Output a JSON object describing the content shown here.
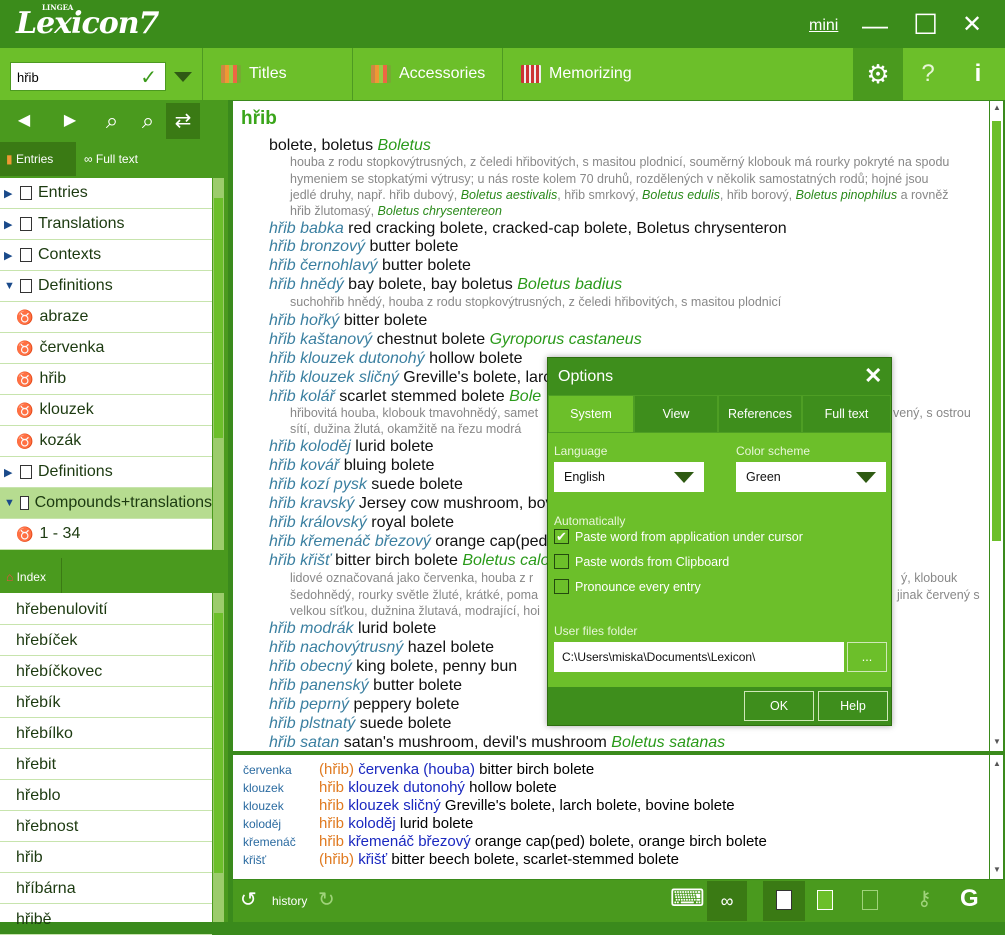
{
  "app": {
    "logo_brand": "LINGEA",
    "logo_text": "Lexicon7",
    "mini_label": "mini"
  },
  "window": {
    "minimize_glyph": "—",
    "maximize_glyph": "☐",
    "close_glyph": "✕"
  },
  "search": {
    "value": "hřib",
    "ok_glyph": "✓"
  },
  "toolbar": {
    "titles": "Titles",
    "accessories": "Accessories",
    "memorizing": "Memorizing",
    "gear": "⚙",
    "help": "?",
    "info": "i"
  },
  "nav": {
    "back": "◀",
    "forward": "▶",
    "search": "⌕",
    "search_in": "⌕",
    "swap": "⇄"
  },
  "left_tabs": {
    "entries": "Entries",
    "fulltext": "Full text"
  },
  "tree": [
    {
      "label": "Entries",
      "kind": "collapsed"
    },
    {
      "label": "Translations",
      "kind": "collapsed"
    },
    {
      "label": "Contexts",
      "kind": "collapsed"
    },
    {
      "label": "Definitions",
      "kind": "expanded"
    },
    {
      "label": "abraze",
      "kind": "leaf"
    },
    {
      "label": "červenka",
      "kind": "leaf"
    },
    {
      "label": "hřib",
      "kind": "leaf"
    },
    {
      "label": "klouzek",
      "kind": "leaf"
    },
    {
      "label": "kozák",
      "kind": "leaf"
    },
    {
      "label": "Definitions",
      "kind": "collapsed"
    },
    {
      "label": "Compounds+translations",
      "kind": "expanded-selected"
    },
    {
      "label": "1 - 34",
      "kind": "leaf"
    }
  ],
  "index": {
    "tab": "Index",
    "items": [
      "hřebenulovití",
      "hřebíček",
      "hřebíčkovec",
      "hřebík",
      "hřebílko",
      "hřebit",
      "hřeblo",
      "hřebnost",
      "hřib",
      "hříbárna",
      "hřibě"
    ]
  },
  "entry": {
    "headword": "hřib",
    "main_translation": "bolete, boletus",
    "main_latin": "Boletus",
    "gloss1": "houba z rodu stopkovýtrusných, z čeledi hřibovitých, s masitou plodnicí, souměrný klobouk má rourky pokryté na spodu",
    "gloss2": "hymeniem se stopkatými výtrusy; u nás roste kolem 70 druhů, rozdělených v několik samostatných rodů; hojné jsou",
    "gloss3a": "jedlé druhy, např. hřib dubový,",
    "gloss3b": "Boletus aestivalis",
    "gloss3c": ", hřib smrkový,",
    "gloss3d": "Boletus edulis",
    "gloss3e": ", hřib borový,",
    "gloss3f": "Boletus pinophilus",
    "gloss3g": "a rovněž",
    "gloss4a": "hřib žlutomasý,",
    "gloss4b": "Boletus chrysentereon",
    "compounds": [
      {
        "cz": "hřib babka",
        "en": "red cracking bolete, cracked-cap bolete, Boletus chrysenteron",
        "lat": ""
      },
      {
        "cz": "hřib bronzový",
        "en": "butter bolete",
        "lat": ""
      },
      {
        "cz": "hřib černohlavý",
        "en": "butter bolete",
        "lat": ""
      },
      {
        "cz": "hřib hnědý",
        "en": "bay bolete, bay boletus",
        "lat": "Boletus badius"
      },
      {
        "cz": "hřib hořký",
        "en": "bitter bolete",
        "lat": ""
      },
      {
        "cz": "hřib kaštanový",
        "en": "chestnut bolete",
        "lat": "Gyroporus castaneus"
      },
      {
        "cz": "hřib klouzek dutonohý",
        "en": "hollow bolete",
        "lat": ""
      },
      {
        "cz": "hřib klouzek sličný",
        "en": "Greville's bolete, larc",
        "lat": ""
      },
      {
        "cz": "hřib kolář",
        "en": "scarlet stemmed bolete",
        "lat": "Bole"
      },
      {
        "cz": "hřib koloděj",
        "en": "lurid bolete",
        "lat": ""
      },
      {
        "cz": "hřib kovář",
        "en": "bluing bolete",
        "lat": ""
      },
      {
        "cz": "hřib kozí pysk",
        "en": "suede bolete",
        "lat": ""
      },
      {
        "cz": "hřib kravský",
        "en": "Jersey cow mushroom, bov",
        "lat": ""
      },
      {
        "cz": "hřib královský",
        "en": "royal bolete",
        "lat": ""
      },
      {
        "cz": "hřib křemenáč březový",
        "en": "orange cap(ped",
        "lat": ""
      },
      {
        "cz": "hřib křišť",
        "en": "bitter birch bolete",
        "lat": "Boletus calo"
      },
      {
        "cz": "hřib modrák",
        "en": "lurid bolete",
        "lat": ""
      },
      {
        "cz": "hřib nachovýtrusný",
        "en": "hazel bolete",
        "lat": ""
      },
      {
        "cz": "hřib obecný",
        "en": "king bolete, penny bun",
        "lat": ""
      },
      {
        "cz": "hřib panenský",
        "en": "butter bolete",
        "lat": ""
      },
      {
        "cz": "hřib peprný",
        "en": "peppery bolete",
        "lat": ""
      },
      {
        "cz": "hřib plstnatý",
        "en": "suede bolete",
        "lat": ""
      },
      {
        "cz": "hřib satan",
        "en": "satan's mushroom, devil's mushroom",
        "lat": "Boletus satanas"
      }
    ],
    "gloss_hnedy": "suchohřib hnědý, houba z rodu stopkovýtrusných, z čeledi hřibovitých, s masitou plodnicí",
    "gloss_kolar1": "hřibovitá houba, klobouk tmavohnědý, samet",
    "gloss_kolar1b": "vený, s ostrou",
    "gloss_kolar2": "sítí, dužina žlutá, okamžitě na řezu modrá",
    "gloss_kris1": "lidové označovaná jako červenka, houba z r",
    "gloss_kris1b": "ý, klobouk",
    "gloss_kris2": "šedohnědý, rourky světle žluté, krátké, poma",
    "gloss_kris2b": "jinak červený s",
    "gloss_kris3": "velkou síťkou, dužnina žlutavá, modrající, hoi"
  },
  "lower": [
    {
      "key": "červenka",
      "a": "(hřib)",
      "b": "červenka",
      "c": "(houba)",
      "d": "bitter birch bolete",
      "a_paren": true
    },
    {
      "key": "klouzek",
      "a": "hřib",
      "b": "klouzek dutonohý",
      "c": "",
      "d": "hollow bolete",
      "a_paren": false
    },
    {
      "key": "klouzek",
      "a": "hřib",
      "b": "klouzek sličný",
      "c": "",
      "d": "Greville's bolete, larch bolete, bovine bolete",
      "a_paren": false
    },
    {
      "key": "koloděj",
      "a": "hřib",
      "b": "koloděj",
      "c": "",
      "d": "lurid bolete",
      "a_paren": false
    },
    {
      "key": "křemenáč",
      "a": "hřib",
      "b": "křemenáč březový",
      "c": "",
      "d": "orange cap(ped) bolete, orange birch bolete",
      "a_paren": false
    },
    {
      "key": "křišť",
      "a": "(hřib)",
      "b": "křišť",
      "c": "",
      "d": "bitter beech bolete, scarlet-stemmed bolete",
      "a_paren": true
    }
  ],
  "bottom": {
    "history": "history",
    "history_icon": "↺",
    "forward_icon": "↻",
    "keyboard": "⌨",
    "g": "G"
  },
  "dialog": {
    "title": "Options",
    "close": "✕",
    "tabs": [
      "System",
      "View",
      "References",
      "Full text"
    ],
    "language_label": "Language",
    "language_value": "English",
    "color_label": "Color scheme",
    "color_value": "Green",
    "auto_label": "Automatically",
    "checks": [
      {
        "label": "Paste word from application under cursor",
        "checked": true
      },
      {
        "label": "Paste words from Clipboard",
        "checked": false
      },
      {
        "label": "Pronounce every entry",
        "checked": false
      }
    ],
    "folder_label": "User files folder",
    "folder_value": "C:\\Users\\miska\\Documents\\Lexicon\\",
    "browse": "...",
    "ok": "OK",
    "help": "Help"
  },
  "colors": {
    "accent": "#6cbf2a",
    "dark": "#3b8c1b",
    "headword": "#3aa51a",
    "link": "#3a7fa0",
    "latin": "#2a9a1a"
  }
}
